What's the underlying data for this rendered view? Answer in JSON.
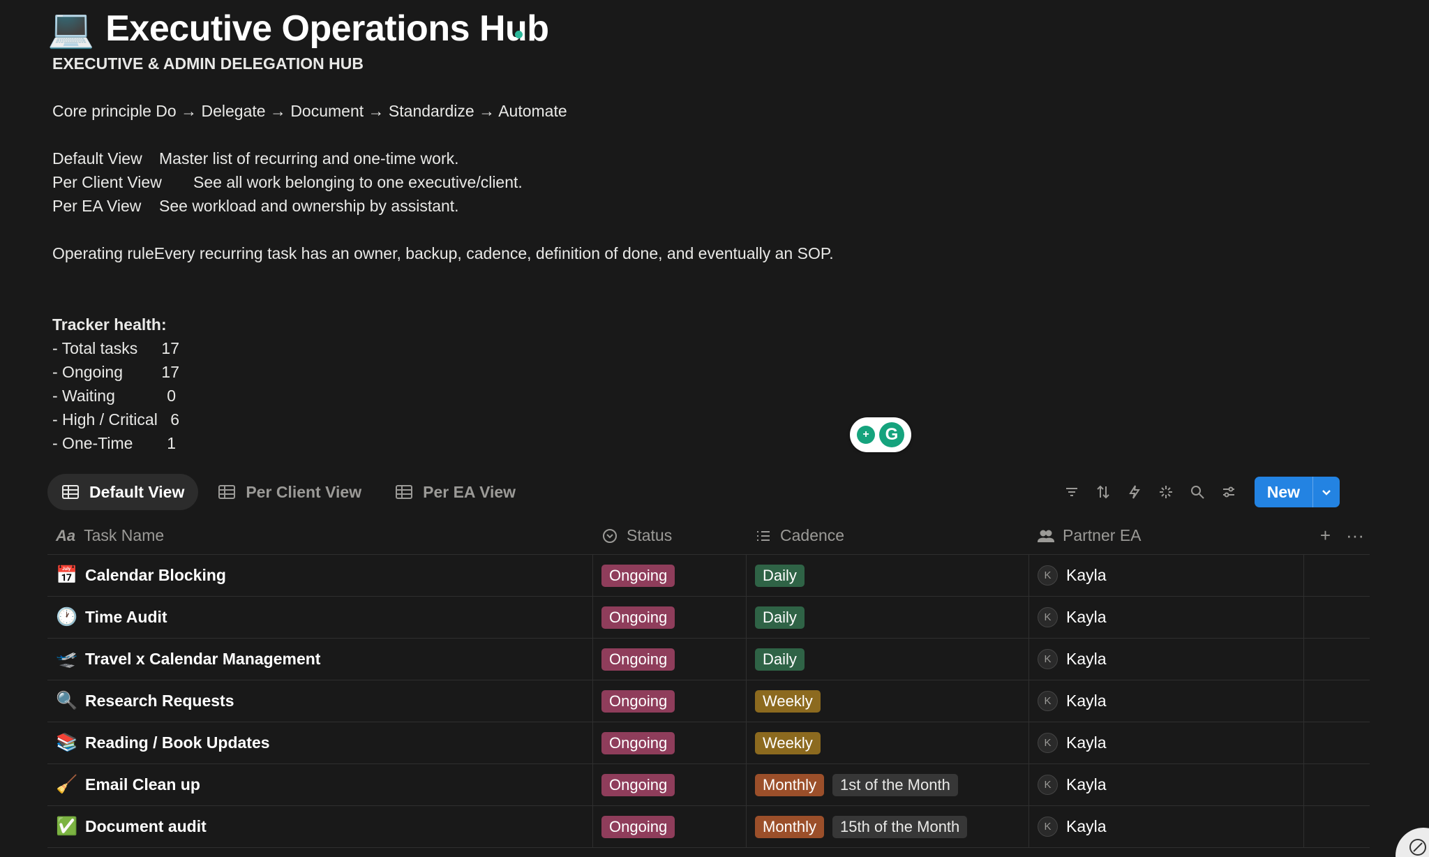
{
  "page": {
    "icon": "💻",
    "title": "Executive Operations Hub"
  },
  "intro": {
    "subtitle": "EXECUTIVE & ADMIN DELEGATION HUB",
    "core_principle_label": "Core principle",
    "core_principle_text": "Do → Delegate → Document → Standardize → Automate",
    "views": [
      {
        "label": "Default View",
        "desc": "Master list of recurring and one-time work."
      },
      {
        "label": "Per Client View",
        "desc": "See all work belonging to one executive/client."
      },
      {
        "label": "Per EA View",
        "desc": "See workload and ownership by assistant."
      }
    ],
    "operating_rule_label": "Operating rule",
    "operating_rule_text": "Every recurring task has an owner, backup, cadence, definition of done, and eventually an SOP."
  },
  "health": {
    "heading": "Tracker health:",
    "items": [
      {
        "label": "- Total tasks",
        "value": "17"
      },
      {
        "label": "- Ongoing",
        "value": "17"
      },
      {
        "label": "- Waiting",
        "value": "0"
      },
      {
        "label": "- High / Critical",
        "value": "6"
      },
      {
        "label": "- One-Time",
        "value": "1"
      }
    ]
  },
  "tabs": [
    {
      "label": "Default View",
      "active": true
    },
    {
      "label": "Per Client View",
      "active": false
    },
    {
      "label": "Per EA View",
      "active": false
    }
  ],
  "toolbar": {
    "icons": [
      "filter-icon",
      "sort-icon",
      "automation-icon",
      "ai-sparkle-icon",
      "search-icon",
      "settings-icon"
    ],
    "new_label": "New"
  },
  "table": {
    "columns": [
      {
        "label": "Task Name",
        "icon": "text-aa-icon"
      },
      {
        "label": "Status",
        "icon": "status-icon"
      },
      {
        "label": "Cadence",
        "icon": "list-icon"
      },
      {
        "label": "Partner EA",
        "icon": "people-icon"
      }
    ],
    "rows": [
      {
        "icon": "📅",
        "name": "Calendar Blocking",
        "status": "Ongoing",
        "cadence": "Daily",
        "cadence_color": "daily",
        "cadence_detail": "",
        "ea_initial": "K",
        "ea": "Kayla"
      },
      {
        "icon": "🕐",
        "name": "Time Audit",
        "status": "Ongoing",
        "cadence": "Daily",
        "cadence_color": "daily",
        "cadence_detail": "",
        "ea_initial": "K",
        "ea": "Kayla"
      },
      {
        "icon": "🛫",
        "name": "Travel x Calendar Management",
        "status": "Ongoing",
        "cadence": "Daily",
        "cadence_color": "daily",
        "cadence_detail": "",
        "ea_initial": "K",
        "ea": "Kayla"
      },
      {
        "icon": "🔍",
        "name": "Research Requests",
        "status": "Ongoing",
        "cadence": "Weekly",
        "cadence_color": "weekly",
        "cadence_detail": "",
        "ea_initial": "K",
        "ea": "Kayla"
      },
      {
        "icon": "📚",
        "name": "Reading / Book Updates",
        "status": "Ongoing",
        "cadence": "Weekly",
        "cadence_color": "weekly",
        "cadence_detail": "",
        "ea_initial": "K",
        "ea": "Kayla"
      },
      {
        "icon": "🧹",
        "name": "Email Clean up",
        "status": "Ongoing",
        "cadence": "Monthly",
        "cadence_color": "monthly",
        "cadence_detail": "1st of the Month",
        "ea_initial": "K",
        "ea": "Kayla"
      },
      {
        "icon": "✅",
        "name": "Document audit",
        "status": "Ongoing",
        "cadence": "Monthly",
        "cadence_color": "monthly",
        "cadence_detail": "15th of the Month",
        "ea_initial": "K",
        "ea": "Kayla"
      }
    ]
  },
  "colors": {
    "background": "#191919",
    "accent": "#2383e2",
    "ongoing": "#8f3d5b",
    "daily": "#2f6346",
    "weekly": "#8c6a1f",
    "monthly": "#9b4f2a"
  }
}
